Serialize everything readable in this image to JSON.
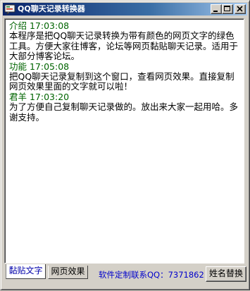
{
  "window": {
    "title": "QQ聊天记录转换器",
    "controls": {
      "minimize": "minimize-icon",
      "maximize": "maximize-icon",
      "close": "close-icon"
    }
  },
  "log": {
    "entries": [
      {
        "header": "介绍 17:03:08",
        "body": "本程序是把QQ聊天记录转换为带有颜色的网页文字的绿色工具。方便大家往博客，论坛等网页黏贴聊天记录。适用于大部分博客论坛。"
      },
      {
        "header": "功能 17:05:08",
        "body": "把QQ聊天记录复制到这个窗口，查看网页效果。直接复制网页效果里面的文字就可以啦！"
      },
      {
        "header": "君羊 17:03:20",
        "body": "为了方便自己复制聊天记录做的。放出来大家一起用哈。多谢支持。"
      }
    ]
  },
  "tabs": [
    {
      "label": "黏贴文字",
      "active": true
    },
    {
      "label": "网页效果",
      "active": false
    }
  ],
  "footer": {
    "contact": "软件定制联系QQ：7371862",
    "replace_button": "姓名替换"
  },
  "colors": {
    "entry_header": "#006400",
    "entry_body": "#000000",
    "contact": "#0000cc",
    "titlebar": "#0a246a"
  }
}
